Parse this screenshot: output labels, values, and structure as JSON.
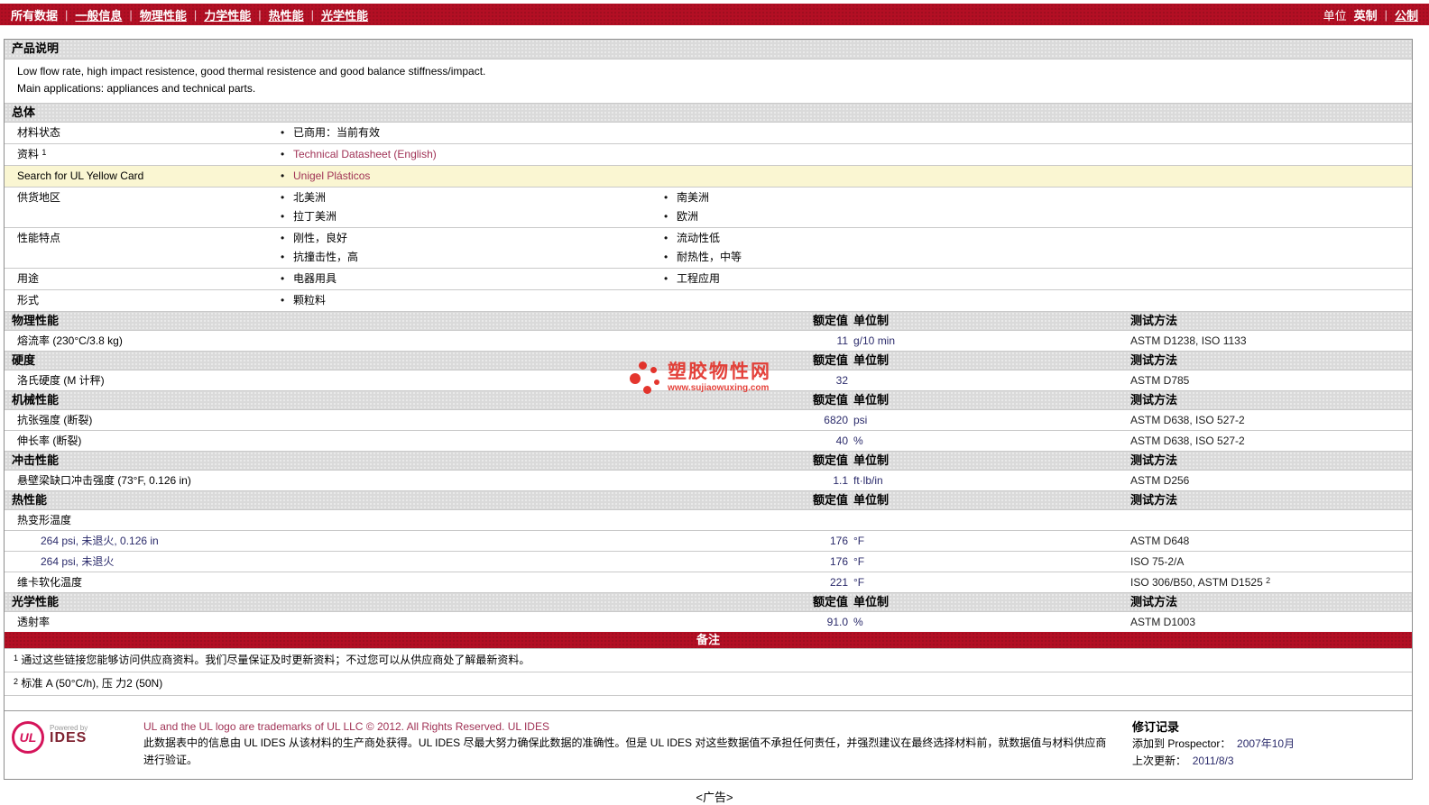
{
  "nav": {
    "items": [
      "所有数据",
      "一般信息",
      "物理性能",
      "力学性能",
      "热性能",
      "光学性能"
    ],
    "units_label": "单位",
    "unit_imperial": "英制",
    "unit_metric": "公制"
  },
  "colors": {
    "accent_red": "#B30F24",
    "link_maroon": "#A03255",
    "value_navy": "#2B2B6B",
    "highlight_yellow": "#FAF6D2"
  },
  "product": {
    "section_title": "产品说明",
    "description_lines": [
      "Low flow rate, high impact resistence, good thermal resistence and good balance stiffness/impact.",
      "Main applications: appliances and technical parts."
    ]
  },
  "general": {
    "section_title": "总体",
    "rows": [
      {
        "label": "材料状态",
        "col1": [
          "已商用：当前有效"
        ],
        "col2": []
      },
      {
        "label": "资料",
        "sup": "1",
        "col1": [
          "Technical Datasheet (English)"
        ],
        "col2": []
      },
      {
        "label": "Search for UL Yellow Card",
        "col1": [
          "Unigel Plásticos"
        ],
        "col2": []
      },
      {
        "label": "供货地区",
        "col1": [
          "北美洲",
          "拉丁美洲"
        ],
        "col2": [
          "南美洲",
          "欧洲"
        ]
      },
      {
        "label": "性能特点",
        "col1": [
          "刚性，良好",
          "抗撞击性，高"
        ],
        "col2": [
          "流动性低",
          "耐热性，中等"
        ]
      },
      {
        "label": "用途",
        "col1": [
          "电器用具"
        ],
        "col2": [
          "工程应用"
        ]
      },
      {
        "label": "形式",
        "col1": [
          "颗粒料"
        ],
        "col2": []
      }
    ]
  },
  "columns": {
    "value_header": "额定值",
    "unit_header": "单位制",
    "method_header": "测试方法"
  },
  "properties": [
    {
      "section": "物理性能",
      "rows": [
        {
          "name": "熔流率  (230°C/3.8 kg)",
          "value": "11",
          "unit": "g/10 min",
          "method": "ASTM D1238, ISO 1133"
        }
      ]
    },
    {
      "section": "硬度",
      "rows": [
        {
          "name": "洛氏硬度  (M 计秤)",
          "value": "32",
          "unit": "",
          "method": "ASTM D785"
        }
      ]
    },
    {
      "section": "机械性能",
      "rows": [
        {
          "name": "抗张强度  (断裂)",
          "value": "6820",
          "unit": "psi",
          "method": "ASTM D638, ISO 527-2"
        },
        {
          "name": "伸长率  (断裂)",
          "value": "40",
          "unit": "%",
          "method": "ASTM D638, ISO 527-2"
        }
      ]
    },
    {
      "section": "冲击性能",
      "rows": [
        {
          "name": "悬壁梁缺口冲击强度  (73°F, 0.126 in)",
          "value": "1.1",
          "unit": "ft·lb/in",
          "method": "ASTM D256"
        }
      ]
    },
    {
      "section": "热性能",
      "rows": [
        {
          "name": "热变形温度"
        },
        {
          "name": "264 psi, 未退火, 0.126 in",
          "value": "176",
          "unit": "°F",
          "method": "ASTM D648"
        },
        {
          "name": "264 psi, 未退火",
          "value": "176",
          "unit": "°F",
          "method": "ISO 75-2/A"
        },
        {
          "name": "维卡软化温度",
          "value": "221",
          "unit": "°F",
          "method": "ISO 306/B50, ASTM D1525",
          "method_sup": "2"
        }
      ]
    },
    {
      "section": "光学性能",
      "rows": [
        {
          "name": "透射率",
          "value": "91.0",
          "unit": "%",
          "method": "ASTM D1003"
        }
      ]
    }
  ],
  "notes": {
    "banner": "备注",
    "items": [
      {
        "sup": "1",
        "text": "通过这些链接您能够访问供应商资料。我们尽量保证及时更新资料；不过您可以从供应商处了解最新资料。"
      },
      {
        "sup": "2",
        "text": "标准  A (50°C/h), 压 力2 (50N)"
      }
    ]
  },
  "footer": {
    "logo_ul": "UL",
    "logo_powered": "Powered by",
    "logo_ides": "IDES",
    "trademark_line": "UL and the UL logo are trademarks of UL LLC © 2012. All Rights Reserved.",
    "trademark_link": "UL IDES",
    "disclaimer": "此数据表中的信息由  UL IDES 从该材料的生产商处获得。UL IDES 尽最大努力确保此数据的准确性。但是  UL IDES 对这些数据值不承担任何责任，并强烈建议在最终选择材料前，就数据值与材料供应商进行验证。",
    "revision_title": "修订记录",
    "added_label": "添加到  Prospector：",
    "added_value": "2007年10月",
    "updated_label": "上次更新：",
    "updated_value": "2011/8/3"
  },
  "watermark": {
    "title": "塑胶物性网",
    "url": "www.sujiaowuxing.com"
  },
  "ad": "<广告>"
}
